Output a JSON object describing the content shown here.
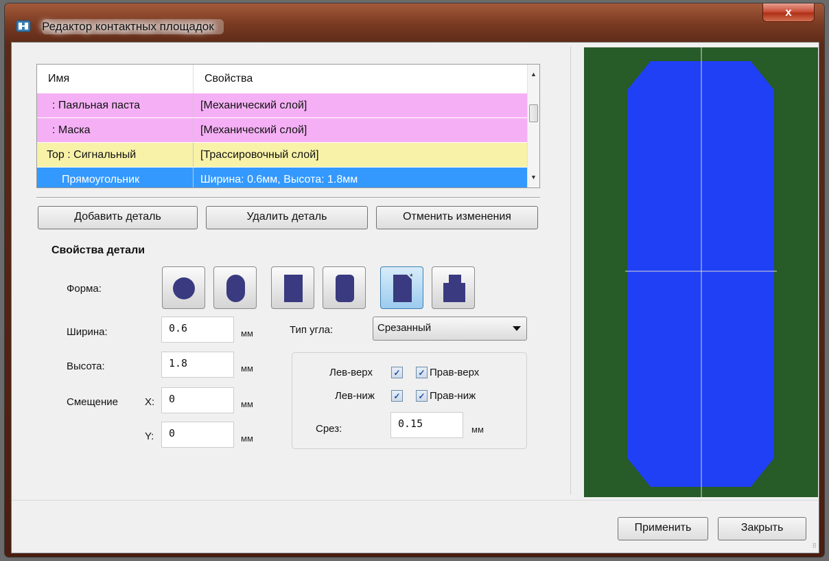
{
  "window": {
    "title": "Редактор контактных площадок",
    "close_label": "x"
  },
  "layers": {
    "columns": [
      "Имя",
      "Свойства"
    ],
    "rows": [
      {
        "name": ": Паяльная паста",
        "props": "[Механический слой]",
        "color": "#f5b0f5"
      },
      {
        "name": ": Маска",
        "props": "[Механический слой]",
        "color": "#f5b0f5"
      },
      {
        "name": "Top : Сигнальный",
        "props": "[Трассировочный слой]",
        "color": "#f8f2a8"
      },
      {
        "name": "Прямоугольник",
        "props": "Ширина: 0.6мм, Высота: 1.8мм",
        "color": "#3399ff",
        "selected": true
      }
    ]
  },
  "buttons": {
    "add": "Добавить деталь",
    "delete": "Удалить деталь",
    "undo": "Отменить изменения",
    "apply": "Применить",
    "close": "Закрыть"
  },
  "props": {
    "title": "Свойства детали",
    "shape_label": "Форма:",
    "shapes": [
      "circle",
      "oval",
      "rectangle",
      "rounded-rectangle",
      "chamfered-rectangle",
      "custom-polygon"
    ],
    "active_shape": "chamfered-rectangle",
    "width_label": "Ширина:",
    "width_value": "0.6",
    "height_label": "Высота:",
    "height_value": "1.8",
    "offset_label": "Смещение",
    "x_label": "X:",
    "x_value": "0",
    "y_label": "Y:",
    "y_value": "0",
    "unit": "мм",
    "corner_type_label": "Тип угла:",
    "corner_type_value": "Срезанный",
    "corners": {
      "top_left": "Лев-верх",
      "top_right": "Прав-верх",
      "bottom_left": "Лев-ниж",
      "bottom_right": "Прав-ниж",
      "checked": "✓"
    },
    "chamfer_label": "Срез:",
    "chamfer_value": "0.15"
  },
  "preview": {
    "background": "#275b27",
    "pad_color": "#2040f5",
    "crosshair_color": "#d8d8d8"
  }
}
